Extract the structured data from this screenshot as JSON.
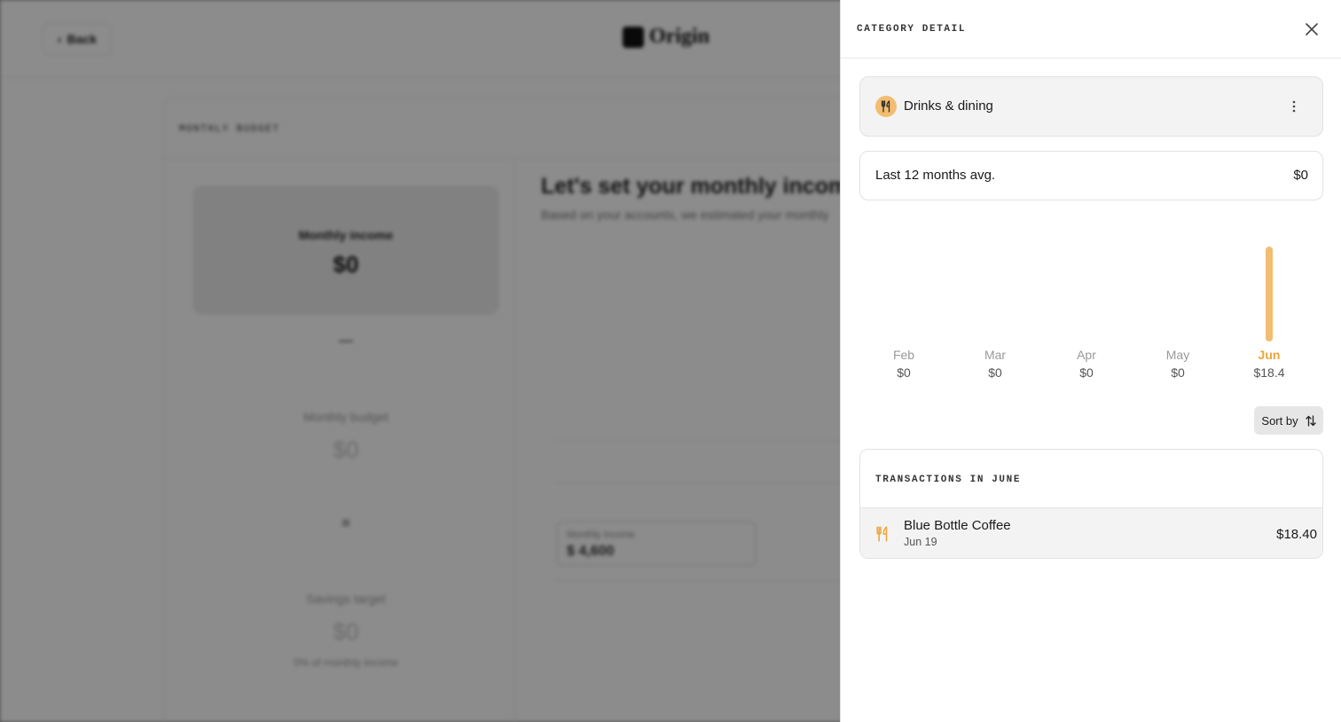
{
  "background": {
    "back_label": "Back",
    "logo_text": "Origin",
    "card_title": "MONTHLY BUDGET",
    "income_label": "Monthly income",
    "income_value": "$0",
    "minus_symbol": "—",
    "budget_label": "Monthly budget",
    "budget_value": "$0",
    "equals_symbol": "=",
    "savings_label": "Savings target",
    "savings_value": "$0",
    "savings_note": "0% of monthly income",
    "headline": "Let's set your monthly income.",
    "subline": "Based on your accounts, we estimated your monthly",
    "field_label": "Monthly income",
    "field_currency": "$",
    "field_value": "4,600"
  },
  "panel": {
    "title": "CATEGORY DETAIL",
    "category": {
      "name": "Drinks & dining",
      "icon": "fork-knife-icon",
      "icon_color": "#f2bd70"
    },
    "average": {
      "label": "Last 12 months avg.",
      "value": "$0"
    },
    "sort_label": "Sort by",
    "transactions_title": "TRANSACTIONS IN JUNE",
    "transactions": [
      {
        "merchant": "Blue Bottle Coffee",
        "date": "Jun 19",
        "amount": "$18.40",
        "icon": "fork-knife-icon"
      }
    ]
  },
  "chart_data": {
    "type": "bar",
    "categories": [
      "Feb",
      "Mar",
      "Apr",
      "May",
      "Jun"
    ],
    "values": [
      0,
      0,
      0,
      0,
      18.4
    ],
    "value_labels": [
      "$0",
      "$0",
      "$0",
      "$0",
      "$18.4"
    ],
    "active_index": 4,
    "bar_color": "#f2bd70",
    "active_label_color": "#eda53b",
    "ylim": [
      0,
      18.4
    ]
  }
}
